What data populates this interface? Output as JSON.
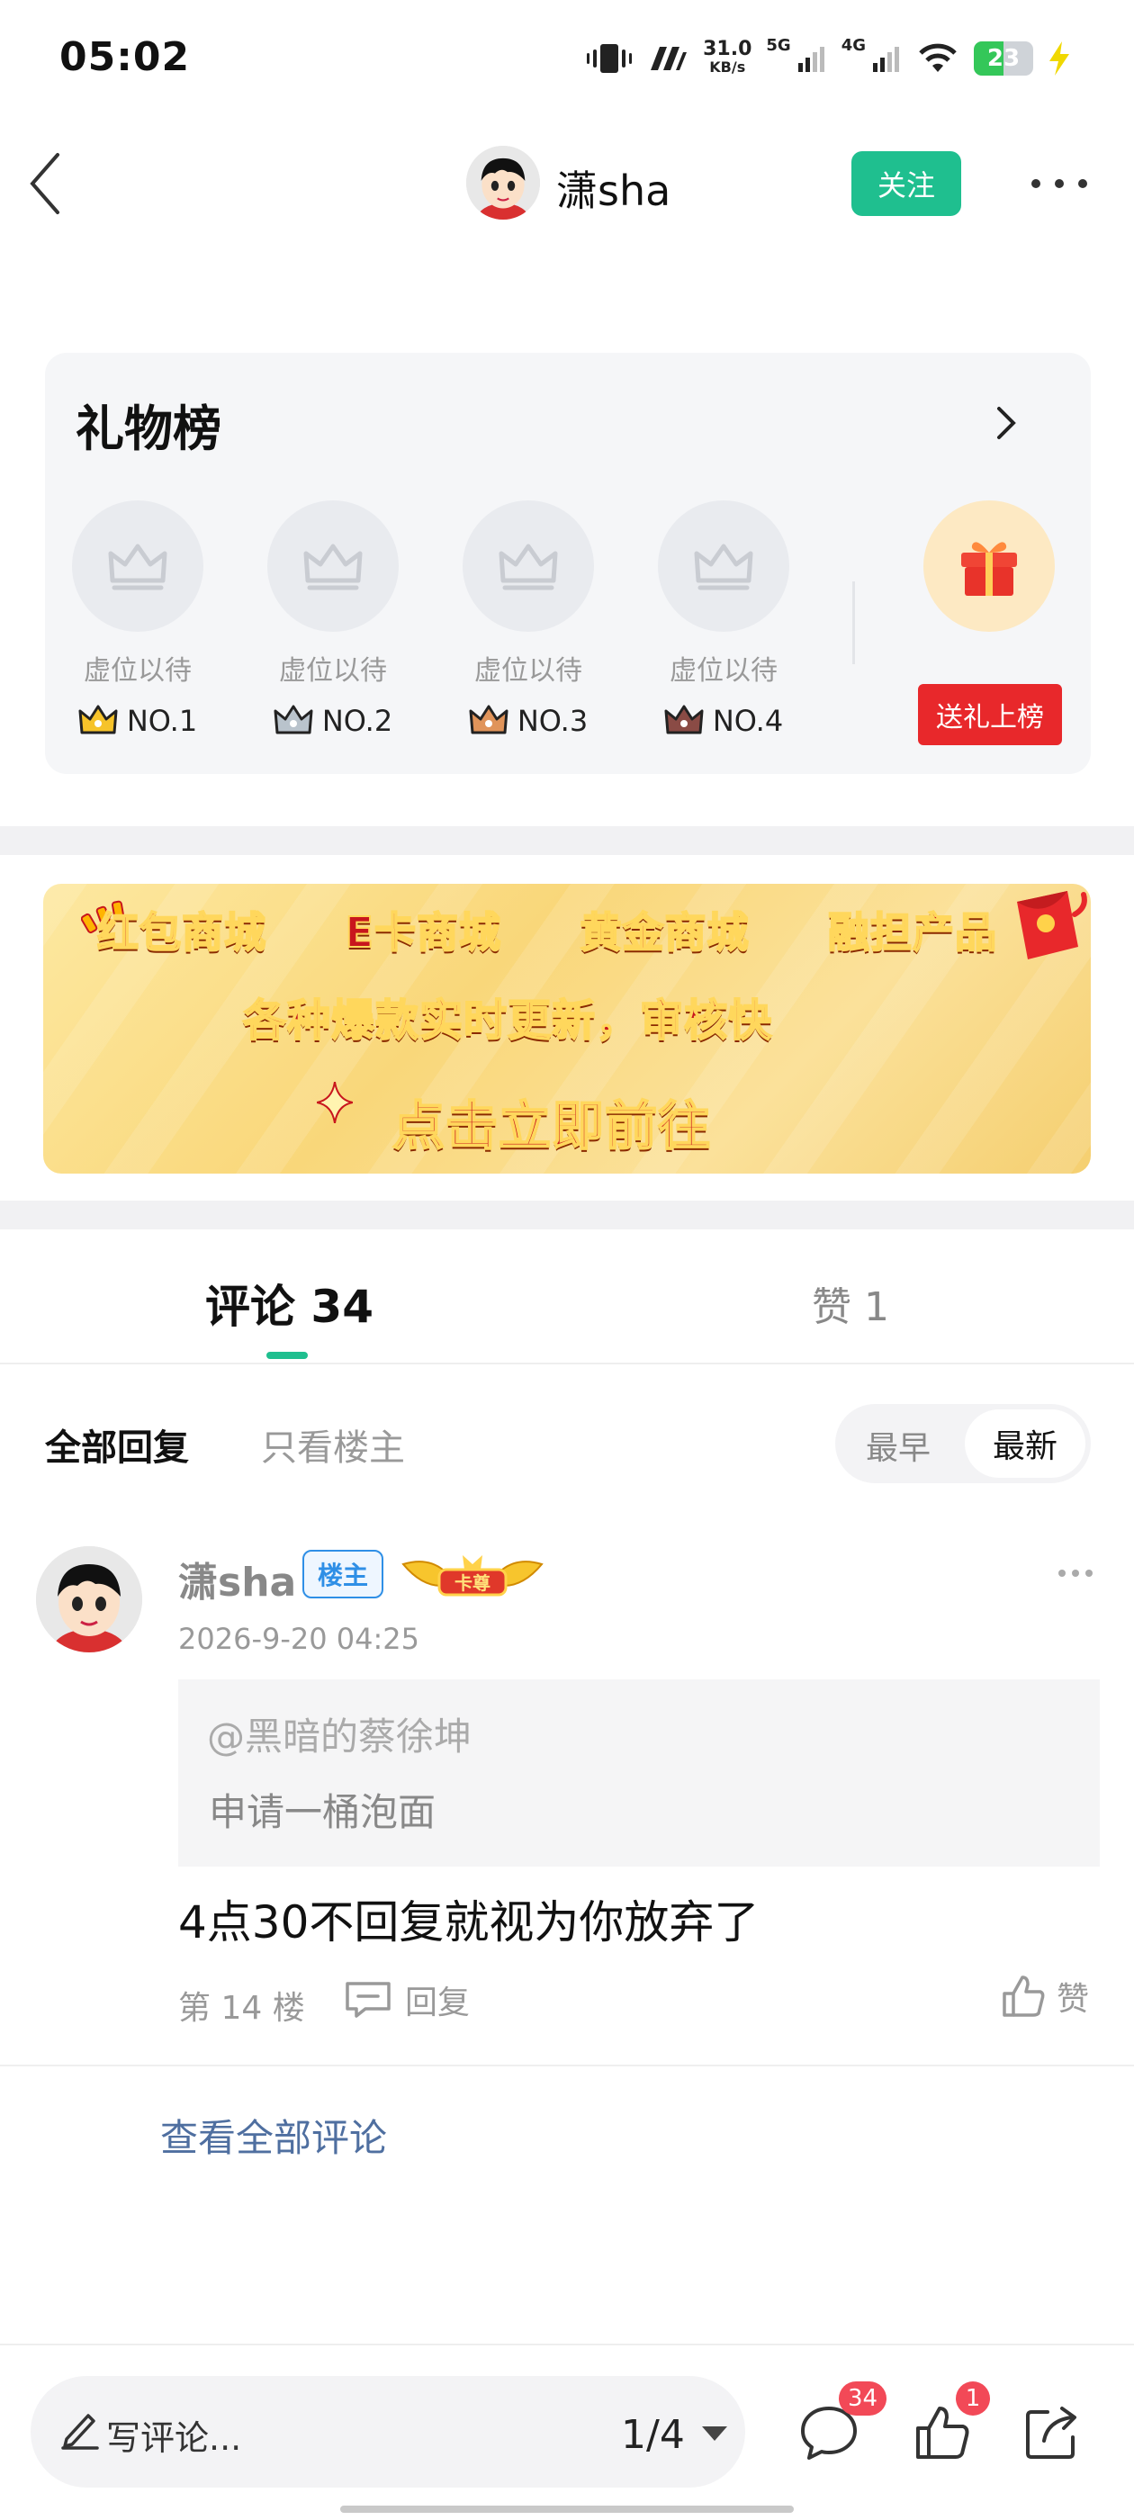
{
  "status_bar": {
    "time": "05:02",
    "net_speed_value": "31.0",
    "net_speed_unit": "KB/s",
    "sim1": "5G",
    "sim2": "4G",
    "battery": "23",
    "icons": [
      "vibrate-icon",
      "nfc-icon",
      "signal-icon",
      "wifi-icon",
      "battery-icon",
      "charging-icon"
    ]
  },
  "header": {
    "username": "潇sha",
    "follow_label": "关注"
  },
  "gift_board": {
    "title": "礼物榜",
    "slots": [
      {
        "label": "虚位以待",
        "rank": "NO.1",
        "crown_color": "#f6c32a"
      },
      {
        "label": "虚位以待",
        "rank": "NO.2",
        "crown_color": "#b9c3cc"
      },
      {
        "label": "虚位以待",
        "rank": "NO.3",
        "crown_color": "#e0945a"
      },
      {
        "label": "虚位以待",
        "rank": "NO.4",
        "crown_color": "#8a4b45"
      }
    ],
    "send_label": "送礼上榜"
  },
  "banner": {
    "items": [
      "红包商城",
      "E卡商城",
      "黄金商城",
      "融担产品"
    ],
    "subtitle": "各种爆款实时更新，审核快",
    "cta": "点击立即前往"
  },
  "tabs": {
    "comments": "评论 34",
    "likes": "赞 1"
  },
  "filters": {
    "all": "全部回复",
    "owner_only": "只看楼主",
    "sort_oldest": "最早",
    "sort_newest": "最新"
  },
  "comment": {
    "author": "潇sha",
    "owner_badge": "楼主",
    "vip_badge": "卡尊",
    "date": "2026-9-20 04:25",
    "quote_user": "@黑暗的蔡徐坤",
    "quote_text": "申请一桶泡面",
    "content": "4点30不回复就视为你放弃了",
    "floor": "第 14 楼",
    "reply_label": "回复",
    "like_label": "赞"
  },
  "view_all": "查看全部评论",
  "bottom_bar": {
    "write_placeholder": "写评论...",
    "page_indicator": "1/4",
    "comment_count": "34",
    "like_count": "1"
  },
  "colors": {
    "accent": "#1fbf8f",
    "red": "#e8282b",
    "link": "#4f6fa0"
  }
}
